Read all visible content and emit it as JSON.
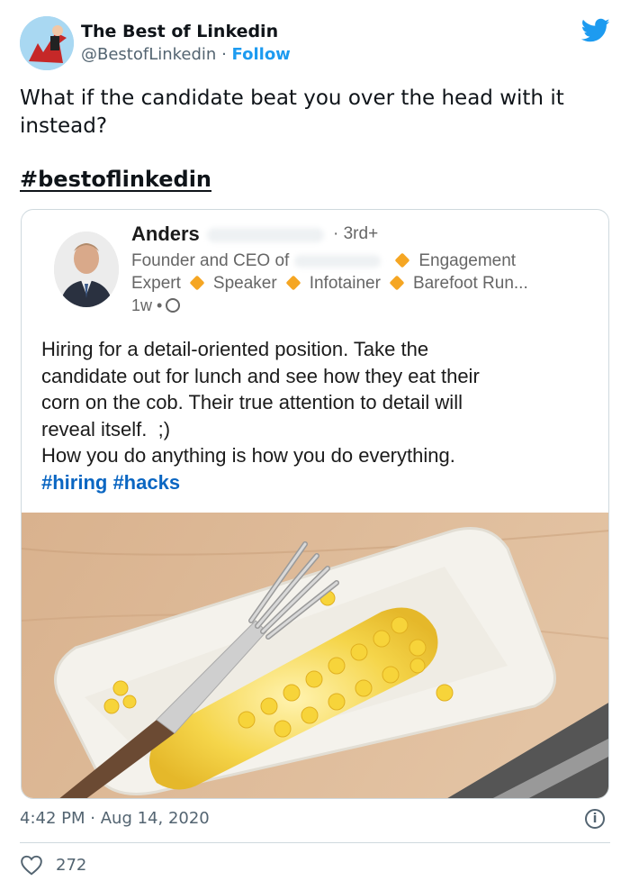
{
  "tweet": {
    "display_name": "The Best of Linkedin",
    "handle": "@BestofLinkedin",
    "separator": "·",
    "follow_label": "Follow",
    "text": "What if the candidate beat you over the head with it instead?",
    "hashtag": "#bestoflinkedin",
    "time": "4:42 PM",
    "date": "Aug 14, 2020",
    "likes": "272"
  },
  "linkedin_post": {
    "author_name": "Anders",
    "degree": "· 3rd+",
    "headline_1a": "Founder and CEO of",
    "headline_1b": "Engagement",
    "headline_2": [
      "Expert",
      "Speaker",
      "Infotainer",
      "Barefoot Run..."
    ],
    "age": "1w •",
    "body_lines": [
      "Hiring for a detail-oriented position. Take the",
      "candidate out for lunch and see how they eat their",
      "corn on the cob. Their true attention to detail will",
      "reveal itself.  ;)",
      "How you do anything is how you do everything."
    ],
    "tags": "#hiring #hacks"
  },
  "colors": {
    "twitter_blue": "#1d9bf0",
    "linkedin_blue": "#0a66c2",
    "diamond_orange": "#f5a623",
    "muted_text": "#536471"
  },
  "icons": [
    "twitter-bird-icon",
    "globe-icon",
    "info-icon",
    "heart-icon"
  ]
}
